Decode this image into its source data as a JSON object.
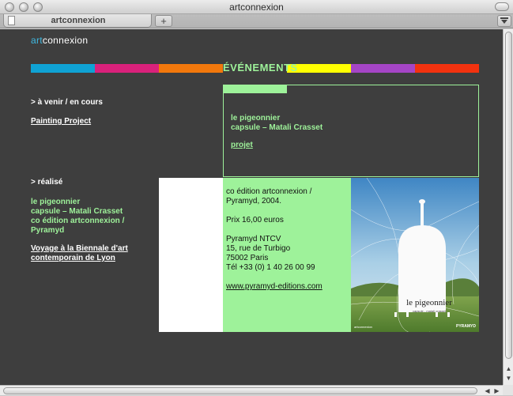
{
  "window": {
    "title": "artconnexion"
  },
  "tabs": [
    {
      "label": "artconnexion"
    }
  ],
  "new_tab_label": "+",
  "page": {
    "logo": {
      "art": "art",
      "rest": "connexion"
    },
    "section_title": "ÉVÉNEMENTS",
    "color_bar": [
      "#0fa2d4",
      "#d9217b",
      "#f2780c",
      "#9ef29a",
      "#ffff00",
      "#a545c6",
      "#f2320f"
    ],
    "sidebar": {
      "upcoming_heading": "> à venir / en cours",
      "upcoming_link": "Painting Project",
      "done_heading": "> réalisé",
      "done_item_lines": [
        "le pigeonnier",
        "capsule – Matali Crasset",
        "co édition artconnexion /",
        "Pyramyd"
      ],
      "done_link_lines": [
        "Voyage à la Biennale d'art",
        "contemporain de Lyon"
      ]
    },
    "feature": {
      "title_lines": [
        "le pigeonnier",
        "capsule – Matali Crasset"
      ],
      "link": "projet"
    },
    "details": {
      "edition_lines": [
        "co édition artconnexion /",
        "Pyramyd, 2004."
      ],
      "price": "Prix 16,00 euros",
      "address_lines": [
        "Pyramyd NTCV",
        "15, rue de Turbigo",
        "75002 Paris",
        "Tél +33 (0) 1 40 26 00 99"
      ],
      "website": "www.pyramyd-editions.com"
    },
    "book_cover": {
      "title": "le pigeonnier",
      "subtitle": "capsule - matali crasset",
      "footer_left": "artconnexion",
      "footer_right": "PYRAMYD"
    }
  },
  "colors": {
    "page_bg": "#3e3e3e",
    "accent_green": "#9ef29a",
    "logo_blue": "#3fb8e0"
  }
}
